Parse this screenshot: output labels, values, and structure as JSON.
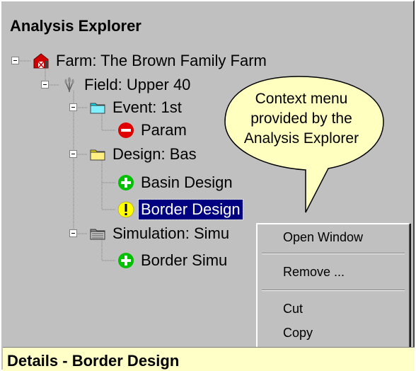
{
  "panel": {
    "title": "Analysis Explorer"
  },
  "tree": {
    "farm": "Farm: The Brown Family Farm",
    "field": "Field: Upper 40",
    "event": "Event: 1st",
    "parameters": "Param",
    "design": "Design: Bas",
    "basin_design": "Basin Design",
    "border_design": "Border Design",
    "simulation": "Simulation: Simu",
    "border_simulation": "Border Simu"
  },
  "callout": {
    "line1": "Context menu",
    "line2": "provided by the",
    "line3": "Analysis Explorer"
  },
  "context_menu": {
    "open_window": "Open Window",
    "remove": "Remove ...",
    "cut": "Cut",
    "copy": "Copy"
  },
  "details": {
    "title": "Details - Border Design"
  },
  "colors": {
    "panel_bg": "#c0c0c0",
    "selection_bg": "#000080",
    "details_bg": "#ffffc8",
    "callout_bg": "#ffffc0",
    "ok_green": "#00c000",
    "error_red": "#e00000",
    "warning_yellow": "#ffff00"
  },
  "icons": {
    "farm": "barn-icon",
    "field": "wheat-icon",
    "event": "cyan-folder-icon",
    "parameters": "error-minus-icon",
    "design": "yellow-folder-icon",
    "basin_design": "ok-plus-icon",
    "border_design": "warning-icon",
    "simulation": "gray-folder-icon",
    "border_simulation": "ok-plus-icon"
  }
}
